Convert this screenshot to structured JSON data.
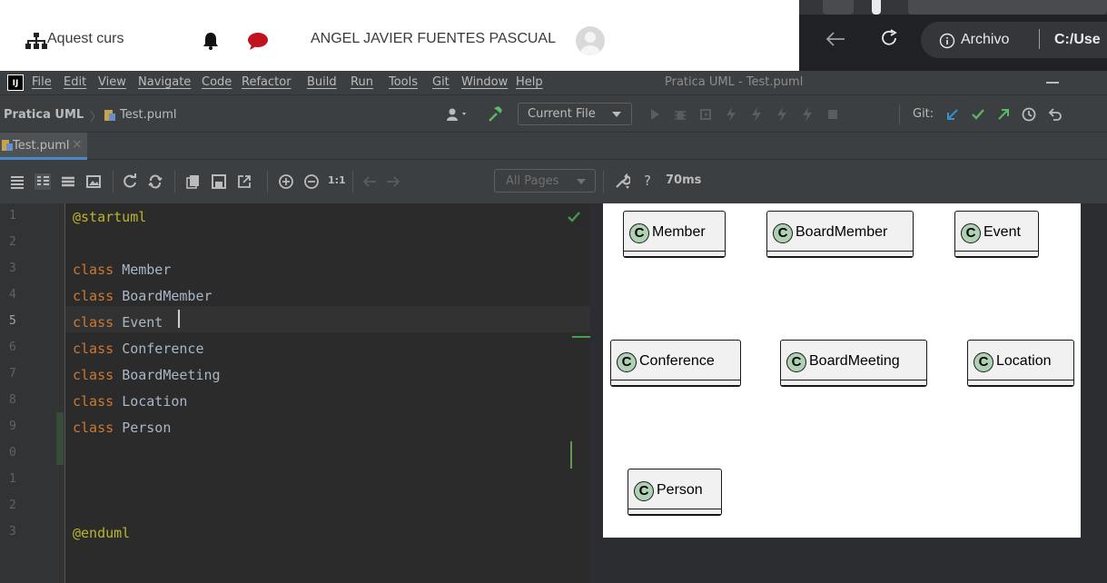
{
  "web": {
    "course_label": "Aquest curs",
    "user_name": "ANGEL JAVIER FUENTES PASCUAL"
  },
  "browser": {
    "url_prefix": "Archivo",
    "url_path": "C:/Use"
  },
  "ide": {
    "logo": "IJ",
    "menu": [
      "File",
      "Edit",
      "View",
      "Navigate",
      "Code",
      "Refactor",
      "Build",
      "Run",
      "Tools",
      "Git",
      "Window",
      "Help"
    ],
    "window_title": "Pratica UML - Test.puml",
    "breadcrumb_project": "Pratica UML",
    "breadcrumb_file": "Test.puml",
    "run_config": "Current File",
    "git_label": "Git:",
    "tab_label": "Test.puml",
    "pages_select": "All Pages",
    "help": "?",
    "timing": "70ms",
    "zoom_reset": "1:1"
  },
  "editor": {
    "line_numbers": [
      "1",
      "2",
      "3",
      "4",
      "5",
      "6",
      "7",
      "8",
      "9",
      "0",
      "1",
      "2",
      "3"
    ],
    "lines": [
      {
        "kw": "@startuml",
        "name": ""
      },
      {
        "kw": "",
        "name": ""
      },
      {
        "kw": "class",
        "name": "Member"
      },
      {
        "kw": "class",
        "name": "BoardMember"
      },
      {
        "kw": "class",
        "name": "Event"
      },
      {
        "kw": "class",
        "name": "Conference"
      },
      {
        "kw": "class",
        "name": "BoardMeeting"
      },
      {
        "kw": "class",
        "name": "Location"
      },
      {
        "kw": "class",
        "name": "Person"
      },
      {
        "kw": "",
        "name": ""
      },
      {
        "kw": "",
        "name": ""
      },
      {
        "kw": "",
        "name": ""
      },
      {
        "kw": "@enduml",
        "name": ""
      }
    ]
  },
  "diagram": {
    "badge": "C",
    "classes": [
      "Member",
      "BoardMember",
      "Event",
      "Conference",
      "BoardMeeting",
      "Location",
      "Person"
    ]
  },
  "colors": {
    "keyword": "#cc7832",
    "annotation": "#bbb529",
    "class_badge": "#add1b2"
  }
}
